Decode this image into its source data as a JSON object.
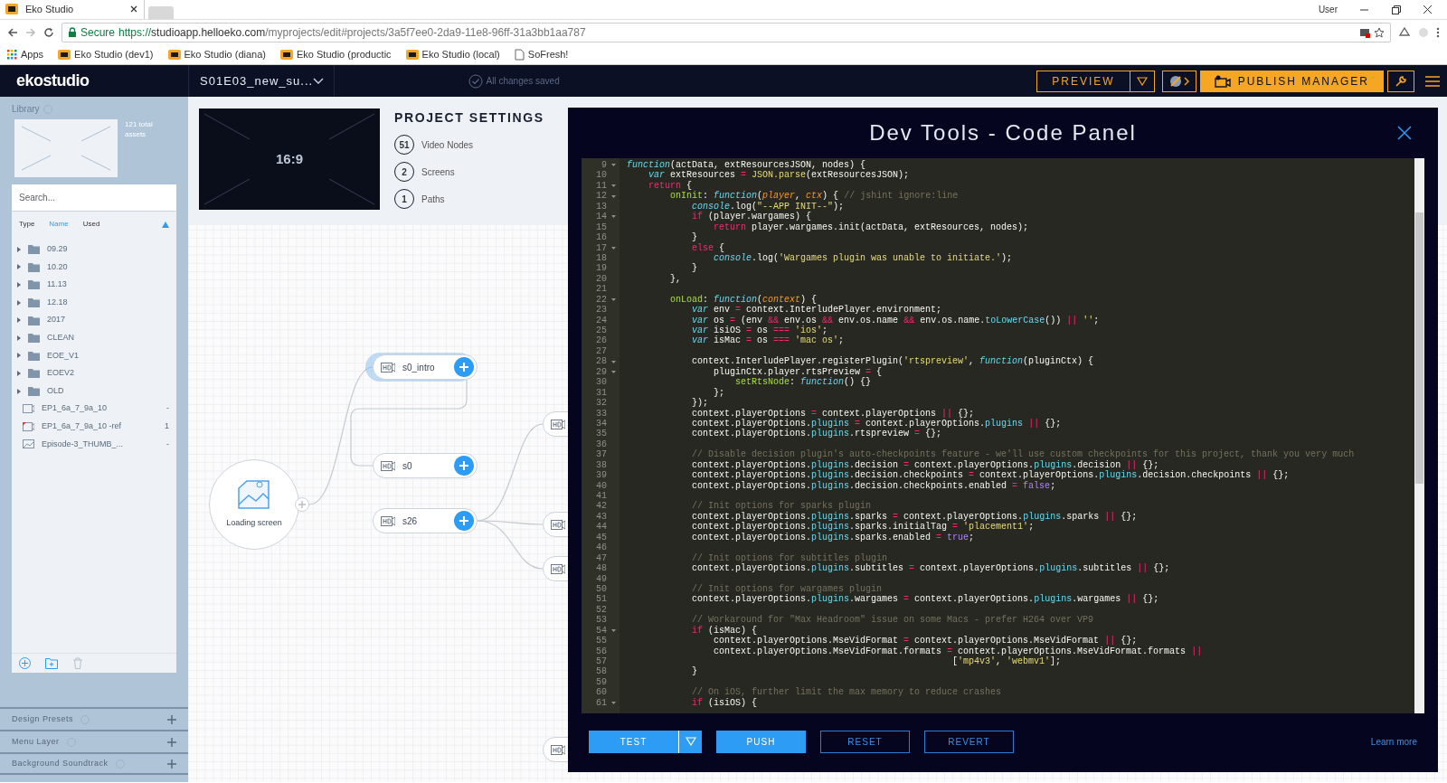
{
  "browser": {
    "tab": {
      "title": "Eko Studio"
    },
    "user": "User",
    "address": {
      "secure_label": "Secure",
      "scheme": "https://",
      "host": "studioapp.helloeko.com",
      "path": "/myprojects/edit#projects/3a5f7ee0-2da9-11e8-96ff-31a3bb1aa787"
    },
    "bookmarks": [
      {
        "kind": "apps",
        "label": "Apps"
      },
      {
        "kind": "site",
        "label": "Eko Studio (dev1)"
      },
      {
        "kind": "site",
        "label": "Eko Studio (diana)"
      },
      {
        "kind": "site",
        "label": "Eko Studio (productic"
      },
      {
        "kind": "site",
        "label": "Eko Studio (local)"
      },
      {
        "kind": "page",
        "label": "SoFresh!"
      }
    ]
  },
  "header": {
    "logo": "ekostudio",
    "project": "S01E03_new_su...",
    "save_status": "All changes saved",
    "preview": "PREVIEW",
    "publish": "PUBLISH MANAGER"
  },
  "library": {
    "title": "Library",
    "asset_count": "121 total assets",
    "search": {
      "placeholder": "Search..."
    },
    "sort_columns": [
      {
        "label": "Type",
        "selected": false
      },
      {
        "label": "Name",
        "selected": true
      },
      {
        "label": "Used",
        "selected": false
      }
    ],
    "items": [
      {
        "kind": "folder",
        "name": "09.29"
      },
      {
        "kind": "folder",
        "name": "10.20"
      },
      {
        "kind": "folder",
        "name": "11.13"
      },
      {
        "kind": "folder",
        "name": "12.18"
      },
      {
        "kind": "folder",
        "name": "2017"
      },
      {
        "kind": "folder",
        "name": "CLEAN"
      },
      {
        "kind": "folder",
        "name": "EOE_V1"
      },
      {
        "kind": "folder",
        "name": "EOEV2"
      },
      {
        "kind": "folder",
        "name": "OLD"
      },
      {
        "kind": "video",
        "name": "EP1_6a_7_9a_10",
        "used": "-",
        "flagged": false
      },
      {
        "kind": "video",
        "name": "EP1_6a_7_9a_10 -ref",
        "used": "1",
        "flagged": true
      },
      {
        "kind": "image",
        "name": "Episode-3_THUMB_...",
        "used": "-"
      }
    ]
  },
  "sidebar_sections": [
    {
      "title": "Design Presets"
    },
    {
      "title": "Menu Layer"
    },
    {
      "title": "Background Soundtrack"
    }
  ],
  "project_settings": {
    "title": "PROJECT SETTINGS",
    "aspect_ratio": "16:9",
    "stats": [
      {
        "count": "51",
        "label": "Video Nodes"
      },
      {
        "count": "2",
        "label": "Screens"
      },
      {
        "count": "1",
        "label": "Paths"
      }
    ]
  },
  "canvas": {
    "loading_screen": {
      "label": "Loading screen"
    },
    "nodes": [
      {
        "label": "s0_intro",
        "selected": true
      },
      {
        "label": "s0",
        "selected": false
      },
      {
        "label": "s26",
        "selected": false
      },
      {
        "selected": false
      },
      {
        "selected": false
      },
      {
        "selected": false
      },
      {
        "selected": false
      }
    ]
  },
  "dev_tools": {
    "title": "Dev Tools - Code Panel",
    "lines": [
      {
        "num": "9",
        "fold": true,
        "segments": [
          {
            "kind": "decl",
            "text": "function"
          },
          {
            "kind": "plain",
            "text": "(actData, extResourcesJSON, nodes) {"
          }
        ]
      },
      {
        "num": "10",
        "fold": false,
        "segments": [
          {
            "kind": "decl",
            "text": "    var"
          },
          {
            "kind": "plain",
            "text": " extResources "
          },
          {
            "kind": "op",
            "text": "="
          },
          {
            "kind": "type",
            "text": " JSON.parse"
          },
          {
            "kind": "plain",
            "text": "(extResourcesJSON);"
          }
        ]
      },
      {
        "num": "11",
        "fold": true,
        "segments": [
          {
            "kind": "op",
            "text": "    return"
          },
          {
            "kind": "plain",
            "text": " {"
          }
        ]
      },
      {
        "num": "12",
        "fold": true,
        "segments": [
          {
            "kind": "key",
            "text": "        onInit"
          },
          {
            "kind": "plain",
            "text": ": "
          },
          {
            "kind": "decl",
            "text": "function"
          },
          {
            "kind": "plain",
            "text": "("
          },
          {
            "kind": "param",
            "text": "player"
          },
          {
            "kind": "plain",
            "text": ", "
          },
          {
            "kind": "param",
            "text": "ctx"
          },
          {
            "kind": "plain",
            "text": ") { "
          },
          {
            "kind": "comment",
            "text": "// jshint ignore:line"
          }
        ]
      },
      {
        "num": "13",
        "fold": false,
        "segments": [
          {
            "kind": "decl",
            "text": "            console"
          },
          {
            "kind": "plain",
            "text": ".log("
          },
          {
            "kind": "string",
            "text": "\"--APP INIT--\""
          },
          {
            "kind": "plain",
            "text": ");"
          }
        ]
      },
      {
        "num": "14",
        "fold": true,
        "segments": [
          {
            "kind": "op",
            "text": "            if"
          },
          {
            "kind": "plain",
            "text": " (player.wargames) {"
          }
        ]
      },
      {
        "num": "15",
        "fold": false,
        "segments": [
          {
            "kind": "op",
            "text": "                return"
          },
          {
            "kind": "plain",
            "text": " player.wargames.init(actData, extResources, nodes);"
          }
        ]
      },
      {
        "num": "16",
        "fold": false,
        "segments": [
          {
            "kind": "plain",
            "text": "            }"
          }
        ]
      },
      {
        "num": "17",
        "fold": true,
        "segments": [
          {
            "kind": "op",
            "text": "            else"
          },
          {
            "kind": "plain",
            "text": " {"
          }
        ]
      },
      {
        "num": "18",
        "fold": false,
        "segments": [
          {
            "kind": "decl",
            "text": "                console"
          },
          {
            "kind": "plain",
            "text": ".log("
          },
          {
            "kind": "string",
            "text": "'Wargames plugin was unable to initiate.'"
          },
          {
            "kind": "plain",
            "text": ");"
          }
        ]
      },
      {
        "num": "19",
        "fold": false,
        "segments": [
          {
            "kind": "plain",
            "text": "            }"
          }
        ]
      },
      {
        "num": "20",
        "fold": false,
        "segments": [
          {
            "kind": "plain",
            "text": "        },"
          }
        ]
      },
      {
        "num": "21",
        "fold": false
      },
      {
        "num": "22",
        "fold": true,
        "segments": [
          {
            "kind": "key",
            "text": "        onLoad"
          },
          {
            "kind": "plain",
            "text": ": "
          },
          {
            "kind": "decl",
            "text": "function"
          },
          {
            "kind": "plain",
            "text": "("
          },
          {
            "kind": "param",
            "text": "context"
          },
          {
            "kind": "plain",
            "text": ") {"
          }
        ]
      },
      {
        "num": "23",
        "fold": false,
        "segments": [
          {
            "kind": "decl",
            "text": "            var"
          },
          {
            "kind": "plain",
            "text": " env "
          },
          {
            "kind": "op",
            "text": "="
          },
          {
            "kind": "plain",
            "text": " context.InterludePlayer.environment;"
          }
        ]
      },
      {
        "num": "24",
        "fold": false,
        "segments": [
          {
            "kind": "decl",
            "text": "            var"
          },
          {
            "kind": "plain",
            "text": " os "
          },
          {
            "kind": "op",
            "text": "="
          },
          {
            "kind": "plain",
            "text": " (env "
          },
          {
            "kind": "op",
            "text": "&&"
          },
          {
            "kind": "plain",
            "text": " env.os "
          },
          {
            "kind": "op",
            "text": "&&"
          },
          {
            "kind": "plain",
            "text": " env.os.name "
          },
          {
            "kind": "op",
            "text": "&&"
          },
          {
            "kind": "plain",
            "text": " env.os.name."
          },
          {
            "kind": "prop",
            "text": "toLowerCase"
          },
          {
            "kind": "plain",
            "text": "()) "
          },
          {
            "kind": "op",
            "text": "||"
          },
          {
            "kind": "string",
            "text": " ''"
          },
          {
            "kind": "plain",
            "text": ";"
          }
        ]
      },
      {
        "num": "25",
        "fold": false,
        "segments": [
          {
            "kind": "decl",
            "text": "            var"
          },
          {
            "kind": "plain",
            "text": " isiOS "
          },
          {
            "kind": "op",
            "text": "="
          },
          {
            "kind": "plain",
            "text": " os "
          },
          {
            "kind": "op",
            "text": "==="
          },
          {
            "kind": "string",
            "text": " 'ios'"
          },
          {
            "kind": "plain",
            "text": ";"
          }
        ]
      },
      {
        "num": "26",
        "fold": false,
        "segments": [
          {
            "kind": "decl",
            "text": "            var"
          },
          {
            "kind": "plain",
            "text": " isMac "
          },
          {
            "kind": "op",
            "text": "="
          },
          {
            "kind": "plain",
            "text": " os "
          },
          {
            "kind": "op",
            "text": "==="
          },
          {
            "kind": "string",
            "text": " 'mac os'"
          },
          {
            "kind": "plain",
            "text": ";"
          }
        ]
      },
      {
        "num": "27",
        "fold": false
      },
      {
        "num": "28",
        "fold": true,
        "segments": [
          {
            "kind": "plain",
            "text": "            context.InterludePlayer.registerPlugin("
          },
          {
            "kind": "string",
            "text": "'rtspreview'"
          },
          {
            "kind": "plain",
            "text": ", "
          },
          {
            "kind": "decl",
            "text": "function"
          },
          {
            "kind": "plain",
            "text": "(pluginCtx) {"
          }
        ]
      },
      {
        "num": "29",
        "fold": true,
        "segments": [
          {
            "kind": "plain",
            "text": "                pluginCtx.player.rtsPreview "
          },
          {
            "kind": "op",
            "text": "="
          },
          {
            "kind": "plain",
            "text": " {"
          }
        ]
      },
      {
        "num": "30",
        "fold": false,
        "segments": [
          {
            "kind": "key",
            "text": "                    setRtsNode"
          },
          {
            "kind": "plain",
            "text": ": "
          },
          {
            "kind": "decl",
            "text": "function"
          },
          {
            "kind": "plain",
            "text": "() {}"
          }
        ]
      },
      {
        "num": "31",
        "fold": false,
        "segments": [
          {
            "kind": "plain",
            "text": "                };"
          }
        ]
      },
      {
        "num": "32",
        "fold": false,
        "segments": [
          {
            "kind": "plain",
            "text": "            });"
          }
        ]
      },
      {
        "num": "33",
        "fold": false,
        "segments": [
          {
            "kind": "plain",
            "text": "            context.playerOptions "
          },
          {
            "kind": "op",
            "text": "="
          },
          {
            "kind": "plain",
            "text": " context.playerOptions "
          },
          {
            "kind": "op",
            "text": "||"
          },
          {
            "kind": "plain",
            "text": " {};"
          }
        ]
      },
      {
        "num": "34",
        "fold": false,
        "segments": [
          {
            "kind": "plain",
            "text": "            context.playerOptions."
          },
          {
            "kind": "prop",
            "text": "plugins"
          },
          {
            "kind": "op",
            "text": " ="
          },
          {
            "kind": "plain",
            "text": " context.playerOptions."
          },
          {
            "kind": "prop",
            "text": "plugins"
          },
          {
            "kind": "op",
            "text": " ||"
          },
          {
            "kind": "plain",
            "text": " {};"
          }
        ]
      },
      {
        "num": "35",
        "fold": false,
        "segments": [
          {
            "kind": "plain",
            "text": "            context.playerOptions."
          },
          {
            "kind": "prop",
            "text": "plugins"
          },
          {
            "kind": "plain",
            "text": ".rtspreview "
          },
          {
            "kind": "op",
            "text": "="
          },
          {
            "kind": "plain",
            "text": " {};"
          }
        ]
      },
      {
        "num": "36",
        "fold": false
      },
      {
        "num": "37",
        "fold": false,
        "segments": [
          {
            "kind": "comment",
            "text": "            // Disable decision plugin's auto-checkpoints feature - we'll use custom checkpoints for this project, thank you very much"
          }
        ]
      },
      {
        "num": "38",
        "fold": false,
        "segments": [
          {
            "kind": "plain",
            "text": "            context.playerOptions."
          },
          {
            "kind": "prop",
            "text": "plugins"
          },
          {
            "kind": "plain",
            "text": ".decision "
          },
          {
            "kind": "op",
            "text": "="
          },
          {
            "kind": "plain",
            "text": " context.playerOptions."
          },
          {
            "kind": "prop",
            "text": "plugins"
          },
          {
            "kind": "plain",
            "text": ".decision "
          },
          {
            "kind": "op",
            "text": "||"
          },
          {
            "kind": "plain",
            "text": " {};"
          }
        ]
      },
      {
        "num": "39",
        "fold": false,
        "segments": [
          {
            "kind": "plain",
            "text": "            context.playerOptions."
          },
          {
            "kind": "prop",
            "text": "plugins"
          },
          {
            "kind": "plain",
            "text": ".decision.checkpoints "
          },
          {
            "kind": "op",
            "text": "="
          },
          {
            "kind": "plain",
            "text": " context.playerOptions."
          },
          {
            "kind": "prop",
            "text": "plugins"
          },
          {
            "kind": "plain",
            "text": ".decision.checkpoints "
          },
          {
            "kind": "op",
            "text": "||"
          },
          {
            "kind": "plain",
            "text": " {};"
          }
        ]
      },
      {
        "num": "40",
        "fold": false,
        "segments": [
          {
            "kind": "plain",
            "text": "            context.playerOptions."
          },
          {
            "kind": "prop",
            "text": "plugins"
          },
          {
            "kind": "plain",
            "text": ".decision.checkpoints.enabled "
          },
          {
            "kind": "op",
            "text": "="
          },
          {
            "kind": "bool",
            "text": " false"
          },
          {
            "kind": "plain",
            "text": ";"
          }
        ]
      },
      {
        "num": "41",
        "fold": false
      },
      {
        "num": "42",
        "fold": false,
        "segments": [
          {
            "kind": "comment",
            "text": "            // Init options for sparks plugin"
          }
        ]
      },
      {
        "num": "43",
        "fold": false,
        "segments": [
          {
            "kind": "plain",
            "text": "            context.playerOptions."
          },
          {
            "kind": "prop",
            "text": "plugins"
          },
          {
            "kind": "plain",
            "text": ".sparks "
          },
          {
            "kind": "op",
            "text": "="
          },
          {
            "kind": "plain",
            "text": " context.playerOptions."
          },
          {
            "kind": "prop",
            "text": "plugins"
          },
          {
            "kind": "plain",
            "text": ".sparks "
          },
          {
            "kind": "op",
            "text": "||"
          },
          {
            "kind": "plain",
            "text": " {};"
          }
        ]
      },
      {
        "num": "44",
        "fold": false,
        "segments": [
          {
            "kind": "plain",
            "text": "            context.playerOptions."
          },
          {
            "kind": "prop",
            "text": "plugins"
          },
          {
            "kind": "plain",
            "text": ".sparks.initialTag "
          },
          {
            "kind": "op",
            "text": "="
          },
          {
            "kind": "string",
            "text": " 'placement1'"
          },
          {
            "kind": "plain",
            "text": ";"
          }
        ]
      },
      {
        "num": "45",
        "fold": false,
        "segments": [
          {
            "kind": "plain",
            "text": "            context.playerOptions."
          },
          {
            "kind": "prop",
            "text": "plugins"
          },
          {
            "kind": "plain",
            "text": ".sparks.enabled "
          },
          {
            "kind": "op",
            "text": "="
          },
          {
            "kind": "bool",
            "text": " true"
          },
          {
            "kind": "plain",
            "text": ";"
          }
        ]
      },
      {
        "num": "46",
        "fold": false
      },
      {
        "num": "47",
        "fold": false,
        "segments": [
          {
            "kind": "comment",
            "text": "            // Init options for subtitles plugin"
          }
        ]
      },
      {
        "num": "48",
        "fold": false,
        "segments": [
          {
            "kind": "plain",
            "text": "            context.playerOptions."
          },
          {
            "kind": "prop",
            "text": "plugins"
          },
          {
            "kind": "plain",
            "text": ".subtitles "
          },
          {
            "kind": "op",
            "text": "="
          },
          {
            "kind": "plain",
            "text": " context.playerOptions."
          },
          {
            "kind": "prop",
            "text": "plugins"
          },
          {
            "kind": "plain",
            "text": ".subtitles "
          },
          {
            "kind": "op",
            "text": "||"
          },
          {
            "kind": "plain",
            "text": " {};"
          }
        ]
      },
      {
        "num": "49",
        "fold": false
      },
      {
        "num": "50",
        "fold": false,
        "segments": [
          {
            "kind": "comment",
            "text": "            // Init options for wargames plugin"
          }
        ]
      },
      {
        "num": "51",
        "fold": false,
        "segments": [
          {
            "kind": "plain",
            "text": "            context.playerOptions."
          },
          {
            "kind": "prop",
            "text": "plugins"
          },
          {
            "kind": "plain",
            "text": ".wargames "
          },
          {
            "kind": "op",
            "text": "="
          },
          {
            "kind": "plain",
            "text": " context.playerOptions."
          },
          {
            "kind": "prop",
            "text": "plugins"
          },
          {
            "kind": "plain",
            "text": ".wargames "
          },
          {
            "kind": "op",
            "text": "||"
          },
          {
            "kind": "plain",
            "text": " {};"
          }
        ]
      },
      {
        "num": "52",
        "fold": false
      },
      {
        "num": "53",
        "fold": false,
        "segments": [
          {
            "kind": "comment",
            "text": "            // Workaround for \"Max Headroom\" issue on some Macs - prefer H264 over VP9"
          }
        ]
      },
      {
        "num": "54",
        "fold": true,
        "segments": [
          {
            "kind": "op",
            "text": "            if"
          },
          {
            "kind": "plain",
            "text": " (isMac) {"
          }
        ]
      },
      {
        "num": "55",
        "fold": false,
        "segments": [
          {
            "kind": "plain",
            "text": "                context.playerOptions.MseVidFormat "
          },
          {
            "kind": "op",
            "text": "="
          },
          {
            "kind": "plain",
            "text": " context.playerOptions.MseVidFormat "
          },
          {
            "kind": "op",
            "text": "||"
          },
          {
            "kind": "plain",
            "text": " {};"
          }
        ]
      },
      {
        "num": "56",
        "fold": false,
        "segments": [
          {
            "kind": "plain",
            "text": "                context.playerOptions.MseVidFormat.formats "
          },
          {
            "kind": "op",
            "text": "="
          },
          {
            "kind": "plain",
            "text": " context.playerOptions.MseVidFormat.formats "
          },
          {
            "kind": "op",
            "text": "||"
          }
        ]
      },
      {
        "num": "57",
        "fold": false,
        "segments": [
          {
            "kind": "plain",
            "text": "                                                            ["
          },
          {
            "kind": "string",
            "text": "'mp4v3'"
          },
          {
            "kind": "plain",
            "text": ", "
          },
          {
            "kind": "string",
            "text": "'webmv1'"
          },
          {
            "kind": "plain",
            "text": "];"
          }
        ]
      },
      {
        "num": "58",
        "fold": false,
        "segments": [
          {
            "kind": "plain",
            "text": "            }"
          }
        ]
      },
      {
        "num": "59",
        "fold": false
      },
      {
        "num": "60",
        "fold": false,
        "segments": [
          {
            "kind": "comment",
            "text": "            // On iOS, further limit the max memory to reduce crashes"
          }
        ]
      },
      {
        "num": "61",
        "fold": true,
        "segments": [
          {
            "kind": "op",
            "text": "            if"
          },
          {
            "kind": "plain",
            "text": " (isiOS) {"
          }
        ]
      }
    ],
    "buttons": [
      {
        "kind": "primary",
        "label": "TEST",
        "dropdown": true
      },
      {
        "kind": "primary",
        "label": "PUSH",
        "dropdown": false
      },
      {
        "kind": "outline",
        "label": "RESET",
        "dropdown": false
      },
      {
        "kind": "outline",
        "label": "REVERT",
        "dropdown": false
      }
    ],
    "link": "Learn more"
  }
}
